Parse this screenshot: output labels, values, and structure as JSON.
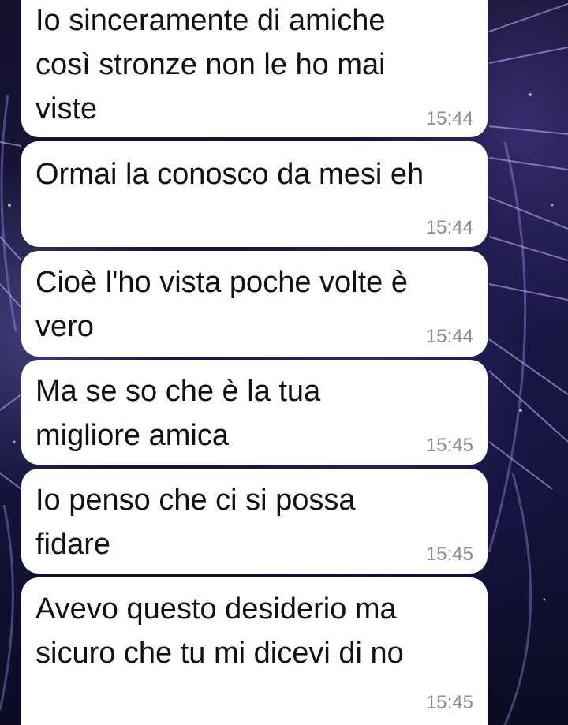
{
  "colors": {
    "bubble_background": "#ffffff",
    "message_text": "#111111",
    "timestamp_text": "#8c8c8c",
    "wallpaper_base": "#14123a"
  },
  "messages": [
    {
      "text": "Io sinceramente di amiche\ncosì stronze non le ho mai\nviste",
      "time": "15:44"
    },
    {
      "text": "Ormai la conosco da mesi eh",
      "time": "15:44"
    },
    {
      "text": "Cioè l'ho vista poche volte è\nvero",
      "time": "15:44"
    },
    {
      "text": "Ma se so che è la tua\nmigliore amica",
      "time": "15:45"
    },
    {
      "text": "Io penso che ci si possa\nfidare",
      "time": "15:45"
    },
    {
      "text": "Avevo questo desiderio ma\nsicuro che tu mi dicevi di no",
      "time": "15:45"
    }
  ]
}
